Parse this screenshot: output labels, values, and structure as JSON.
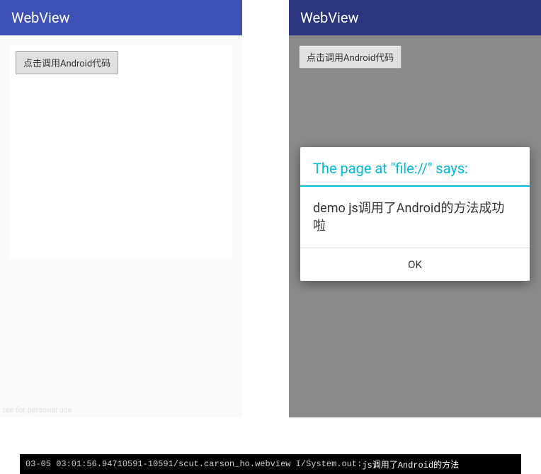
{
  "left": {
    "header_title": "WebView",
    "button_label": "点击调用Android代码",
    "watermark": "ree for personal use"
  },
  "right": {
    "header_title": "WebView",
    "button_label": "点击调用Android代码",
    "dialog": {
      "title": "The page at \"file://\" says:",
      "message": "demo js调用了Android的方法成功啦",
      "ok_label": "OK"
    }
  },
  "log": {
    "timestamp": "03-05 03:01:56.947",
    "pid": "10591-10591",
    "tag": "scut.carson_ho.webview I/System.out:",
    "message": "js调用了Android的方法"
  }
}
